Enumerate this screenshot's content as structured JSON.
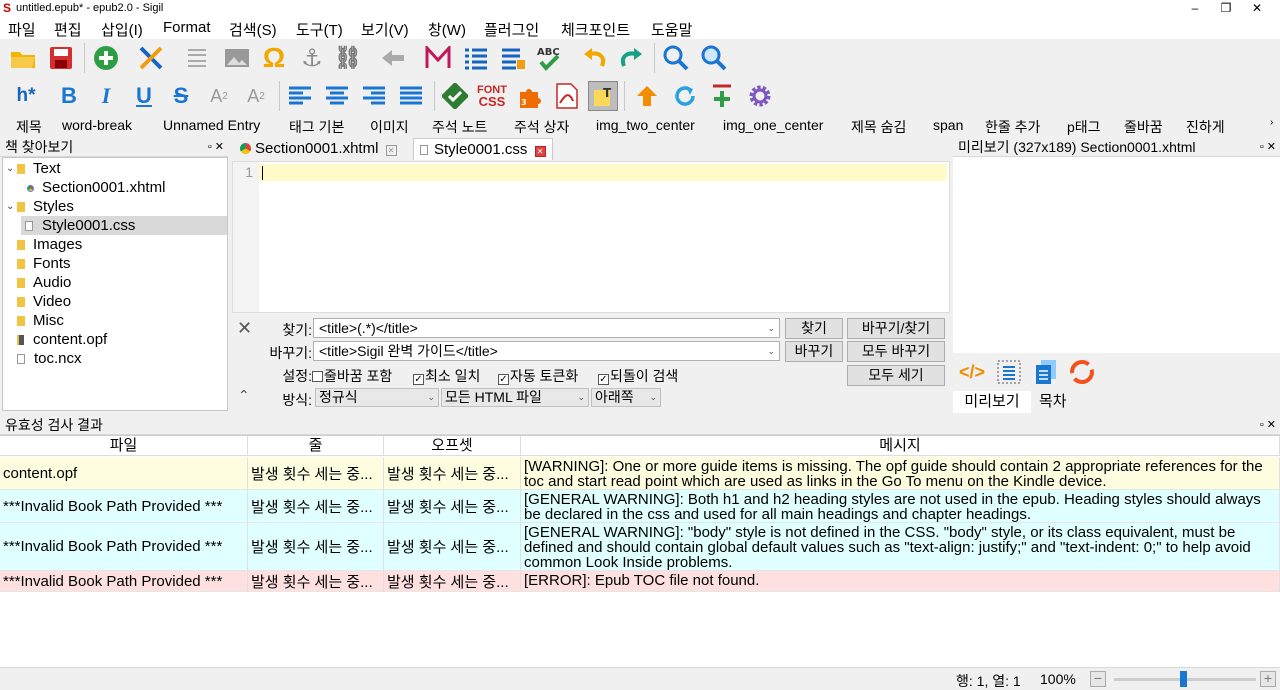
{
  "window": {
    "title": "untitled.epub* - epub2.0 - Sigil",
    "minimize": "–",
    "maximize": "❐",
    "close": "✕"
  },
  "menu": [
    "파일",
    "편집",
    "삽입(I)",
    "Format",
    "검색(S)",
    "도구(T)",
    "보기(V)",
    "창(W)",
    "플러그인",
    "체크포인트",
    "도움말"
  ],
  "clips": [
    "제목",
    "word-break",
    "Unnamed Entry",
    "태그 기본",
    "이미지",
    "주석 노트",
    "주석 상자",
    "img_two_center",
    "img_one_center",
    "제목 숨김",
    "span",
    "한줄 추가",
    "p태그",
    "줄바꿈",
    "진하게"
  ],
  "bookbrowser": {
    "title": "책 찾아보기",
    "items": [
      "Text",
      "Section0001.xhtml",
      "Styles",
      "Style0001.css",
      "Images",
      "Fonts",
      "Audio",
      "Video",
      "Misc",
      "content.opf",
      "toc.ncx"
    ]
  },
  "editor": {
    "tabs": [
      {
        "label": "Section0001.xhtml"
      },
      {
        "label": "Style0001.css"
      }
    ],
    "line": "1"
  },
  "find": {
    "find_label": "찾기:",
    "find_value": "<title>(.*)</title>",
    "replace_label": "바꾸기:",
    "replace_value": "<title>Sigil 완벽 가이드</title>",
    "options_label": "설정:",
    "options": [
      "줄바꿈 포함",
      "최소 일치",
      "자동 토큰화",
      "되돌이 검색"
    ],
    "mode_label": "방식:",
    "mode": "정규식",
    "scope": "모든 HTML 파일",
    "direction": "아래쪽",
    "btn_find": "찾기",
    "btn_replace_find": "바꾸기/찾기",
    "btn_replace": "바꾸기",
    "btn_replace_all": "모두 바꾸기",
    "btn_count_all": "모두 세기"
  },
  "preview": {
    "title": "미리보기 (327x189) Section0001.xhtml",
    "tab_preview": "미리보기",
    "tab_toc": "목차"
  },
  "validation": {
    "title": "유효성 검사 결과",
    "headers": [
      "파일",
      "줄",
      "오프셋",
      "메시지"
    ],
    "rows": [
      {
        "file": "content.opf",
        "line": "발생 횟수 세는 중...",
        "offset": "발생 횟수 세는 중...",
        "msg": "[WARNING]: One or more guide items is missing. The opf guide should contain 2 appropriate references for the toc and start read point which are used as links in the Go To menu on the Kindle device.",
        "color": "#fffde0"
      },
      {
        "file": "***Invalid Book Path Provided ***",
        "line": "발생 횟수 세는 중...",
        "offset": "발생 횟수 세는 중...",
        "msg": "[GENERAL WARNING]: Both h1 and h2 heading styles are not used in the epub. Heading styles should always be declared in the css and used for all main headings and chapter headings.",
        "color": "#e0ffff"
      },
      {
        "file": "***Invalid Book Path Provided ***",
        "line": "발생 횟수 세는 중...",
        "offset": "발생 횟수 세는 중...",
        "msg": "[GENERAL WARNING]: \"body\" style is not defined in the CSS. \"body\" style, or its class equivalent, must be defined and should contain global default values such as \"text-align: justify;\" and \"text-indent: 0;\" to help avoid common Look Inside problems.",
        "color": "#e0ffff"
      },
      {
        "file": "***Invalid Book Path Provided ***",
        "line": "발생 횟수 세는 중...",
        "offset": "발생 횟수 세는 중...",
        "msg": "[ERROR]: Epub TOC file not found.",
        "color": "#ffe0e0"
      }
    ]
  },
  "status": {
    "position": "행: 1, 열: 1",
    "zoom": "100%"
  }
}
